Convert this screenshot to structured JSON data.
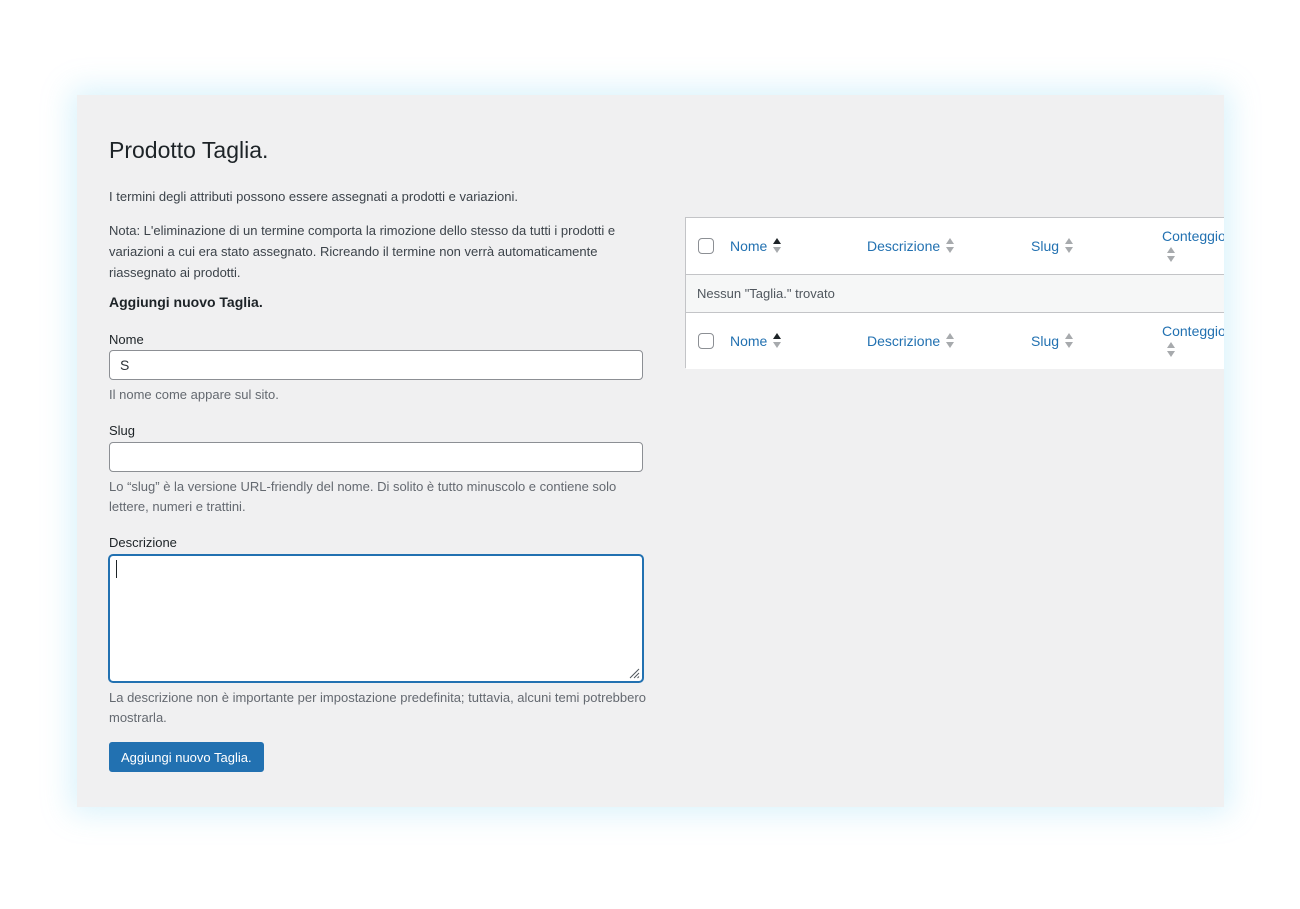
{
  "page": {
    "title": "Prodotto Taglia.",
    "intro": "I termini degli attributi possono essere assegnati a prodotti e variazioni.",
    "note": "Nota: L'eliminazione di un termine comporta la rimozione dello stesso da tutti i prodotti e variazioni a cui era stato assegnato. Ricreando il termine non verrà automaticamente riassegnato ai prodotti."
  },
  "form": {
    "heading": "Aggiungi nuovo Taglia.",
    "name": {
      "label": "Nome",
      "value": "S",
      "help": "Il nome come appare sul sito."
    },
    "slug": {
      "label": "Slug",
      "value": "",
      "help": "Lo “slug” è la versione URL-friendly del nome. Di solito è tutto minuscolo e contiene solo lettere, numeri e trattini."
    },
    "description": {
      "label": "Descrizione",
      "value": "",
      "help": "La descrizione non è importante per impostazione predefinita; tuttavia, alcuni temi potrebbero mostrarla."
    },
    "submit_label": "Aggiungi nuovo Taglia."
  },
  "table": {
    "columns": {
      "name": "Nome",
      "description": "Descrizione",
      "slug": "Slug",
      "count": "Conteggio"
    },
    "sorted_by": "name",
    "empty_message": "Nessun \"Taglia.\" trovato"
  },
  "colors": {
    "accent": "#2271b1",
    "background": "#f0f0f1"
  }
}
